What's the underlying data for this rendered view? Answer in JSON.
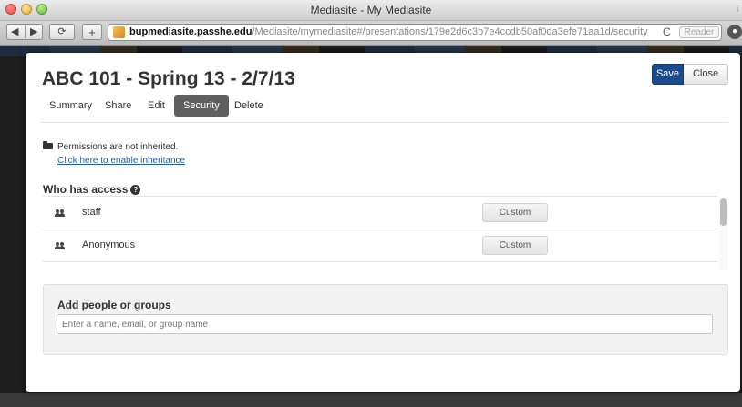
{
  "window": {
    "title": "Mediasite - My Mediasite",
    "edge_glyph": "i"
  },
  "toolbar": {
    "back_glyph": "◀",
    "forward_glyph": "▶",
    "reload_glyph": "⟳",
    "plus_glyph": "+",
    "url_host": "bupmediasite.passhe.edu",
    "url_path": "/Mediasite/mymediasite#/presentations/179e2d6c3b7e4ccdb50af0da3efe71aa1d/security",
    "refresh_glyph": "C",
    "reader_label": "Reader",
    "downloads_glyph": "●"
  },
  "modal": {
    "title": "ABC 101 - Spring 13 - 2/7/13",
    "save_label": "Save",
    "close_label": "Close",
    "tabs": [
      {
        "label": "Summary",
        "active": false
      },
      {
        "label": "Share",
        "active": false
      },
      {
        "label": "Edit",
        "active": false
      },
      {
        "label": "Security",
        "active": true
      },
      {
        "label": "Delete",
        "active": false
      }
    ],
    "inherit_note": "Permissions are not inherited.",
    "inherit_link": "Click here to enable inheritance",
    "access_heading": "Who has access",
    "help_glyph": "?",
    "access": [
      {
        "name": "staff",
        "permission": "Custom"
      },
      {
        "name": "Anonymous",
        "permission": "Custom"
      },
      {
        "name": "",
        "permission": ""
      }
    ],
    "add_heading": "Add people or groups",
    "add_placeholder": "Enter a name, email, or group name"
  },
  "colors": {
    "primary": "#1b4b8c",
    "active_tab": "#5f5f5f",
    "link": "#1f5fa8"
  }
}
